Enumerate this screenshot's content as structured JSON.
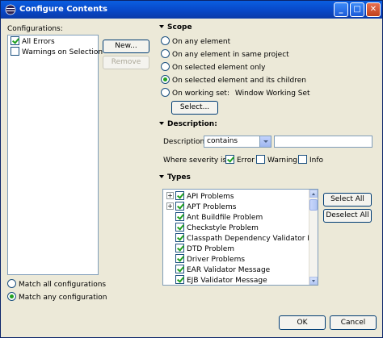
{
  "window": {
    "title": "Configure Contents"
  },
  "configurations": {
    "label": "Configurations:",
    "items": [
      {
        "label": "All Errors",
        "checked": true
      },
      {
        "label": "Warnings on Selection",
        "checked": false
      }
    ],
    "new_button": "New...",
    "remove_button": "Remove",
    "match_all": "Match all configurations",
    "match_any": "Match any configuration"
  },
  "scope": {
    "heading": "Scope",
    "options": [
      "On any element",
      "On any element in same project",
      "On selected element only",
      "On selected element and its children",
      "On working set:"
    ],
    "working_set_value": "Window Working Set",
    "select_button": "Select..."
  },
  "description": {
    "heading": "Description:",
    "field_label": "Description",
    "combo_value": "contains",
    "text_value": "",
    "severity_label": "Where severity is:",
    "severity_error": "Error",
    "severity_warning": "Warning",
    "severity_info": "Info"
  },
  "types": {
    "heading": "Types",
    "items": [
      "API Problems",
      "APT Problems",
      "Ant Buildfile Problem",
      "Checkstyle Problem",
      "Classpath Dependency Validator Mess",
      "DTD Problem",
      "Driver Problems",
      "EAR Validator Message",
      "EJB Validator Message"
    ],
    "select_all": "Select All",
    "deselect_all": "Deselect All"
  },
  "footer": {
    "ok": "OK",
    "cancel": "Cancel"
  },
  "icons": {
    "app": "eclipse-icon"
  }
}
